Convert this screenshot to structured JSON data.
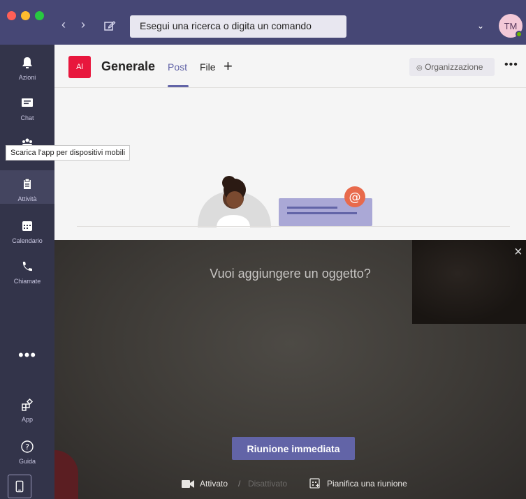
{
  "titlebar": {
    "search_placeholder": "Esegui una ricerca o digita un comando",
    "avatar_initials": "TM"
  },
  "rail": {
    "items": [
      {
        "label": "Azioni",
        "icon": "bell-icon"
      },
      {
        "label": "Chat",
        "icon": "chat-icon"
      },
      {
        "label": "Teams",
        "icon": "teams-icon"
      },
      {
        "label": "Attività",
        "icon": "assignments-icon"
      },
      {
        "label": "Calendario",
        "icon": "calendar-icon"
      },
      {
        "label": "Chiamate",
        "icon": "phone-icon"
      },
      {
        "label": "App",
        "icon": "apps-icon"
      },
      {
        "label": "Guida",
        "icon": "help-icon"
      }
    ],
    "more_label": "•••",
    "tooltip": "Scarica l'app per dispositivi mobili"
  },
  "channel": {
    "team_initials": "Al",
    "title": "Generale",
    "tabs": [
      {
        "label": "Post",
        "active": true
      },
      {
        "label": "File",
        "active": false
      }
    ],
    "add_tab": "+",
    "org_button": "Organizzazione",
    "more": "•••"
  },
  "meeting": {
    "subject_placeholder": "Vuoi aggiungere un oggetto?",
    "meet_now": "Riunione immediata",
    "camera_on": "Attivato",
    "separator": "/",
    "camera_off": "Disattivato",
    "schedule": "Pianifica una riunione",
    "close": "×"
  },
  "colors": {
    "titlebar": "#464775",
    "rail": "#33344a",
    "accent": "#6264a7",
    "team_tile": "#e8173d"
  }
}
